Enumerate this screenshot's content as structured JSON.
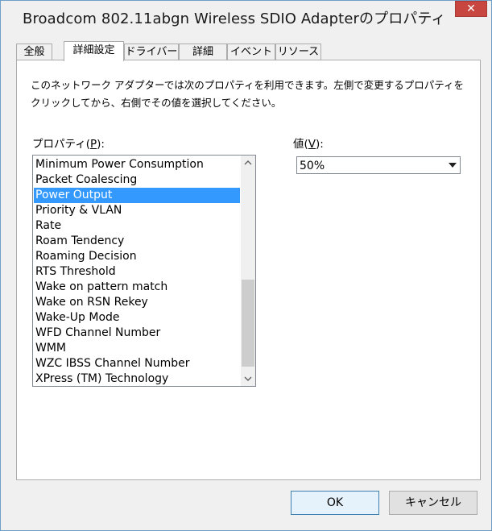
{
  "window": {
    "title": "Broadcom 802.11abgn Wireless SDIO Adapterのプロパティ",
    "close_glyph": "✕"
  },
  "tabs": [
    {
      "label": "全般",
      "active": false
    },
    {
      "label": "詳細設定",
      "active": true
    },
    {
      "label": "ドライバー",
      "active": false
    },
    {
      "label": "詳細",
      "active": false
    },
    {
      "label": "イベント",
      "active": false
    },
    {
      "label": "リソース",
      "active": false
    }
  ],
  "advanced": {
    "description": "このネットワーク アダプターでは次のプロパティを利用できます。左側で変更するプロパティをクリックしてから、右側でその値を選択してください。",
    "property_label_pre": "プロパティ(",
    "property_label_key": "P",
    "property_label_post": "):",
    "value_label_pre": "値(",
    "value_label_key": "V",
    "value_label_post": "):",
    "properties": [
      "Minimum Power Consumption",
      "Packet Coalescing",
      "Power Output",
      "Priority & VLAN",
      "Rate",
      "Roam Tendency",
      "Roaming Decision",
      "RTS Threshold",
      "Wake on pattern match",
      "Wake on RSN Rekey",
      "Wake-Up Mode",
      "WFD Channel Number",
      "WMM",
      "WZC IBSS Channel Number",
      "XPress (TM) Technology"
    ],
    "selected_property": "Power Output",
    "value": "50%"
  },
  "buttons": {
    "ok": "OK",
    "cancel": "キャンセル"
  },
  "colors": {
    "selection": "#3399ff",
    "close_button": "#c7463f",
    "window_border": "#6f9ec8"
  }
}
